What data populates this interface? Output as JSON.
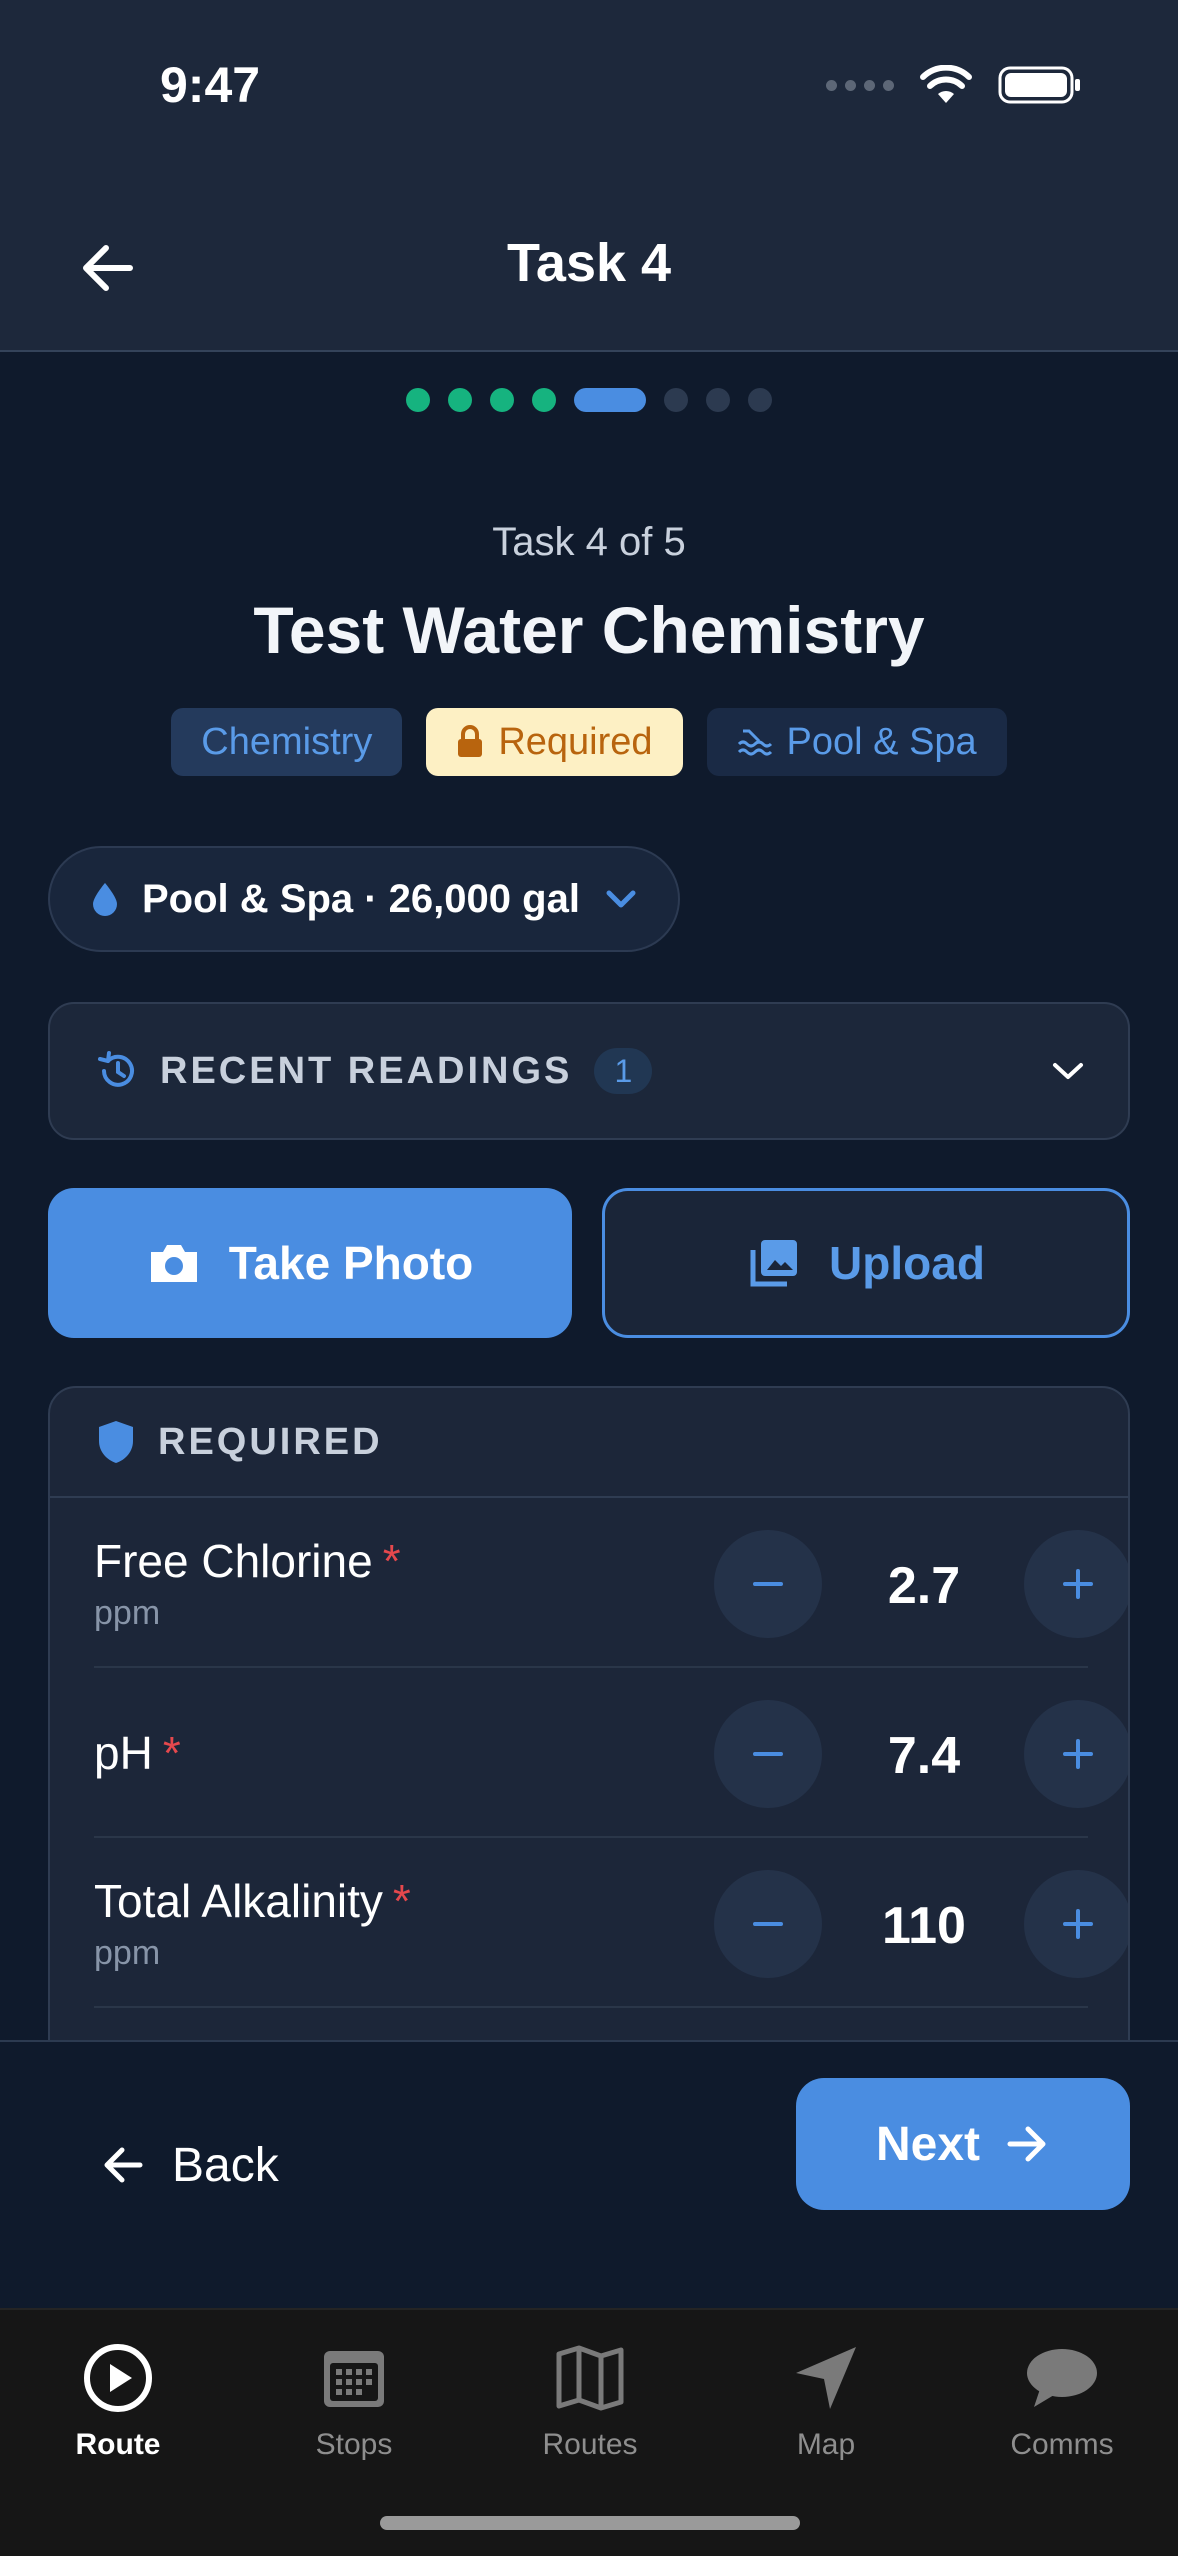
{
  "status_bar": {
    "time": "9:47"
  },
  "header": {
    "title": "Task 4",
    "back_icon": "arrow-left-icon"
  },
  "progress": {
    "total_steps": 8,
    "completed_steps": 4,
    "current_step": 5
  },
  "task": {
    "count_label": "Task 4 of 5",
    "title": "Test Water Chemistry",
    "badges": [
      {
        "label": "Chemistry",
        "icon": ""
      },
      {
        "label": "Required",
        "icon": "lock-icon"
      },
      {
        "label": "Pool & Spa",
        "icon": "pool-icon"
      }
    ]
  },
  "pool_selector": {
    "label": "Pool & Spa · 26,000 gal",
    "icon": "water-drop-icon"
  },
  "recent_readings": {
    "label": "RECENT READINGS",
    "count": "1"
  },
  "photo_actions": {
    "take_photo": "Take Photo",
    "upload": "Upload"
  },
  "required_section": {
    "label": "REQUIRED",
    "rows": [
      {
        "name": "Free Chlorine",
        "unit": "ppm",
        "value": "2.7",
        "required": "*"
      },
      {
        "name": "pH",
        "unit": "",
        "value": "7.4",
        "required": "*"
      },
      {
        "name": "Total Alkalinity",
        "unit": "ppm",
        "value": "110",
        "required": "*"
      }
    ]
  },
  "nav_actions": {
    "back": "Back",
    "next": "Next"
  },
  "tabbar": {
    "tabs": [
      {
        "label": "Route",
        "icon": "play-circle-icon",
        "active": true
      },
      {
        "label": "Stops",
        "icon": "calendar-icon",
        "active": false
      },
      {
        "label": "Routes",
        "icon": "map-fold-icon",
        "active": false
      },
      {
        "label": "Map",
        "icon": "navigation-arrow-icon",
        "active": false
      },
      {
        "label": "Comms",
        "icon": "chat-bubble-icon",
        "active": false
      }
    ]
  },
  "colors": {
    "accent": "#4a8de1",
    "success": "#16b37f",
    "danger": "#e5484d",
    "background": "#0f1a2c"
  }
}
